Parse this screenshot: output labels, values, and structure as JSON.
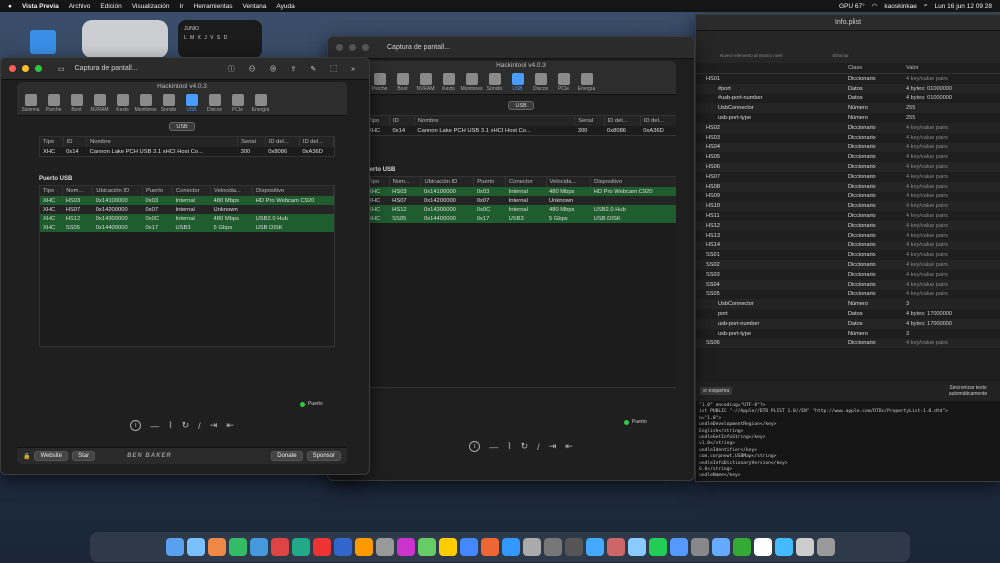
{
  "menubar": {
    "app": "Vista Previa",
    "items": [
      "Archivo",
      "Edición",
      "Visualización",
      "Ir",
      "Herramientas",
      "Ventana",
      "Ayuda"
    ],
    "gpu": "GPU 67°",
    "user": "kaoskinkae",
    "datetime": "Lun 16 jun 12 09 28"
  },
  "calendar": {
    "month": "JUNIO",
    "days": "L M X J V S D"
  },
  "window_front": {
    "title": "Captura de pantall...",
    "app_title": "Hackintool v4.0.3"
  },
  "window_back": {
    "title": "Captura de pantall...",
    "app_title": "Hackintool v4.0.3"
  },
  "plist_window": {
    "title": "Info.plist",
    "toolbar": [
      "Nuevo elemento al mismo nivel",
      "Eliminar"
    ]
  },
  "tabs": [
    "Sistema",
    "Parche",
    "Boot",
    "NVRAM",
    "Kexts",
    "Monitores",
    "Sonido",
    "USB",
    "Discos",
    "PCIe",
    "Energía"
  ],
  "tabs_back": [
    "Parche",
    "Boot",
    "NVRAM",
    "Kexts",
    "Monitores",
    "Sonido",
    "USB",
    "Discos",
    "PCIe",
    "Energía"
  ],
  "usb_button": "USB",
  "controller_headers": [
    "Tipo",
    "ID",
    "Nombre",
    "Serial",
    "ID del...",
    "ID del..."
  ],
  "controller_row": [
    "XHC",
    "0x14",
    "Cannon Lake PCH USB 3.1 xHCI Host Co...",
    "300",
    "0x8086",
    "0xA36D"
  ],
  "port_section": "Puerto USB",
  "port_section_back": "uerto USB",
  "port_headers": [
    "Tipo",
    "Nom...",
    "Ubicación ID",
    "Puerto",
    "Conector",
    "Velocida...",
    "Dispositivo"
  ],
  "port_rows": [
    [
      "XHC",
      "HS03",
      "0x14100000",
      "0x03",
      "Internal",
      "480 Mbps",
      "HD Pro Webcam C920"
    ],
    [
      "XHC",
      "HS07",
      "0x14200000",
      "0x07",
      "Internal",
      "Unknown",
      ""
    ],
    [
      "XHC",
      "HS12",
      "0x14300000",
      "0x0C",
      "Internal",
      "480 Mbps",
      "USB2.0 Hub"
    ],
    [
      "XHC",
      "SS05",
      "0x14400000",
      "0x17",
      "USB3",
      "5 Gbps",
      "USB DISK"
    ]
  ],
  "legend": "Puerto",
  "footer": {
    "website": "Website",
    "star": "Star",
    "brand": "BEN BAKER",
    "donate": "Donate",
    "sponsor": "Sponsor"
  },
  "plist_headers": [
    "Clase",
    "Valor"
  ],
  "plist_rows": [
    [
      "HS01",
      "Diccionario",
      "4 key/value pairs"
    ],
    [
      "#port",
      "Datos",
      "4 bytes: 01000000"
    ],
    [
      "#usb-port-number",
      "Datos",
      "4 bytes: 01000000"
    ],
    [
      "UsbConnector",
      "Número",
      "255"
    ],
    [
      "usb-port-type",
      "Número",
      "255"
    ],
    [
      "HS02",
      "Diccionario",
      "4 key/value pairs"
    ],
    [
      "HS03",
      "Diccionario",
      "4 key/value pairs"
    ],
    [
      "HS04",
      "Diccionario",
      "4 key/value pairs"
    ],
    [
      "HS05",
      "Diccionario",
      "4 key/value pairs"
    ],
    [
      "HS06",
      "Diccionario",
      "4 key/value pairs"
    ],
    [
      "HS07",
      "Diccionario",
      "4 key/value pairs"
    ],
    [
      "HS08",
      "Diccionario",
      "4 key/value pairs"
    ],
    [
      "HS09",
      "Diccionario",
      "4 key/value pairs"
    ],
    [
      "HS10",
      "Diccionario",
      "4 key/value pairs"
    ],
    [
      "HS11",
      "Diccionario",
      "4 key/value pairs"
    ],
    [
      "HS12",
      "Diccionario",
      "4 key/value pairs"
    ],
    [
      "HS13",
      "Diccionario",
      "4 key/value pairs"
    ],
    [
      "HS14",
      "Diccionario",
      "4 key/value pairs"
    ],
    [
      "SS01",
      "Diccionario",
      "4 key/value pairs"
    ],
    [
      "SS02",
      "Diccionario",
      "4 key/value pairs"
    ],
    [
      "SS03",
      "Diccionario",
      "4 key/value pairs"
    ],
    [
      "SS04",
      "Diccionario",
      "4 key/value pairs"
    ],
    [
      "SS05",
      "Diccionario",
      "4 key/value pairs"
    ],
    [
      "UsbConnector",
      "Número",
      "3"
    ],
    [
      "port",
      "Datos",
      "4 bytes: 17000000"
    ],
    [
      "usb-port-number",
      "Datos",
      "4 bytes: 17000000"
    ],
    [
      "usb-port-type",
      "Número",
      "3"
    ],
    [
      "SS06",
      "Diccionario",
      "4 key/value pairs"
    ]
  ],
  "plist_sync": "Sincronizar texto automáticamente",
  "plist_scheme": "sr esquema",
  "plist_code": [
    "\"1.0\" encoding=\"UTF-8\"?>",
    "ist PUBLIC \"-//Apple//DTD PLIST 1.0//EN\" \"http://www.apple.com/DTDs/PropertyList-1.0.dtd\">",
    "n=\"1.0\">",
    "undleDevelopmentRegion</key>",
    "English</string>",
    "undleGetInfoString</key>",
    "v1.0</string>",
    "undleIdentifier</key>",
    "com.corpnewt.USBMap</string>",
    "undleInfoDictionaryVersion</key>",
    "6.0</string>",
    "undleName</key>"
  ]
}
